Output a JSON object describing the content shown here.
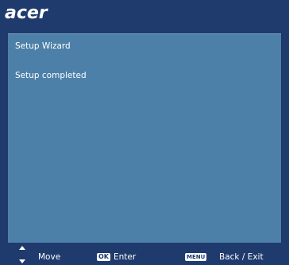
{
  "brand": {
    "logo_text": "acer"
  },
  "panel": {
    "title": "Setup Wizard",
    "status": "Setup completed"
  },
  "footer": {
    "move_label": "Move",
    "ok_key": "OK",
    "enter_label": "Enter",
    "menu_key": "MENU",
    "back_label": "Back / Exit"
  },
  "colors": {
    "frame_background": "#1f3a6d",
    "panel_background": "#4d80a8",
    "text": "#ffffff"
  },
  "icons": [
    "arrow-up-icon",
    "arrow-down-icon",
    "ok-key-icon",
    "menu-key-icon"
  ]
}
